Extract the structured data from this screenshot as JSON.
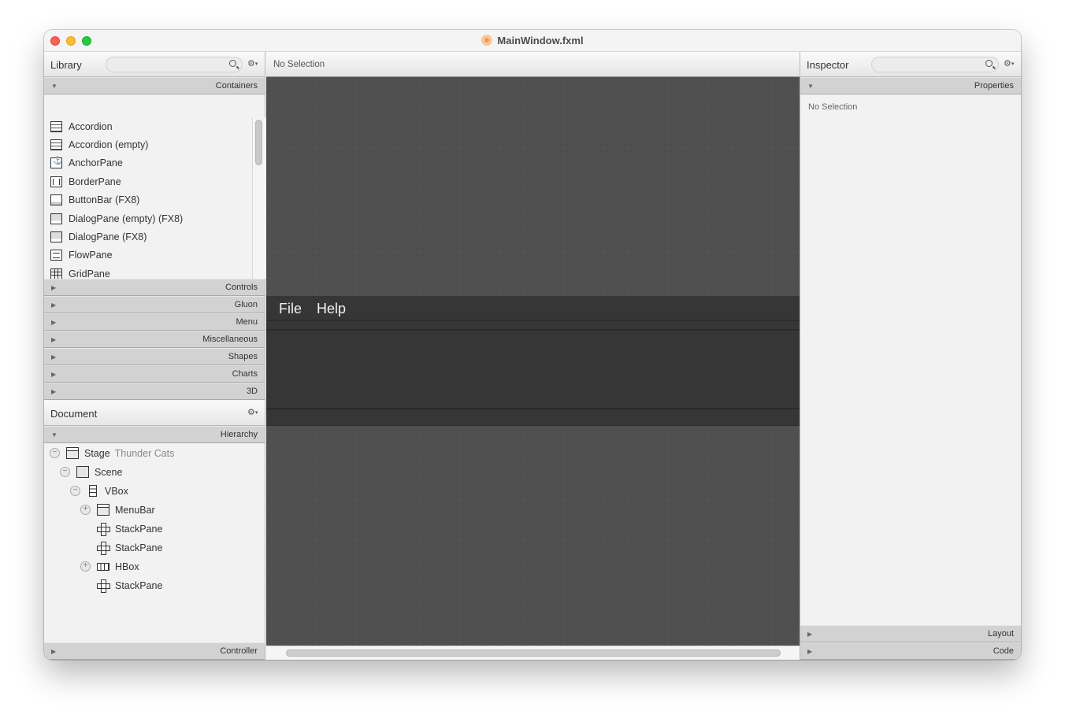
{
  "window": {
    "title": "MainWindow.fxml",
    "title_icon": "fxml-file-icon"
  },
  "library": {
    "title": "Library",
    "search_placeholder": "",
    "expanded_section": "Containers",
    "items": [
      {
        "label": "Accordion",
        "icon": "accordion-icon"
      },
      {
        "label": "Accordion  (empty)",
        "icon": "accordion-icon"
      },
      {
        "label": "AnchorPane",
        "icon": "anchor-pane-icon"
      },
      {
        "label": "BorderPane",
        "icon": "border-pane-icon"
      },
      {
        "label": "ButtonBar  (FX8)",
        "icon": "button-bar-icon"
      },
      {
        "label": "DialogPane (empty)  (FX8)",
        "icon": "dialog-pane-icon"
      },
      {
        "label": "DialogPane  (FX8)",
        "icon": "dialog-pane-icon"
      },
      {
        "label": "FlowPane",
        "icon": "flow-pane-icon"
      },
      {
        "label": "GridPane",
        "icon": "grid-pane-icon"
      }
    ],
    "collapsed_sections": [
      "Controls",
      "Gluon",
      "Menu",
      "Miscellaneous",
      "Shapes",
      "Charts",
      "3D"
    ]
  },
  "document": {
    "title": "Document",
    "section": "Hierarchy",
    "tree": [
      {
        "label": "Stage",
        "sub": "Thunder Cats",
        "toggle": "−",
        "icon": "stage"
      },
      {
        "label": "Scene",
        "sub": "",
        "toggle": "−",
        "icon": "scene"
      },
      {
        "label": "VBox",
        "sub": "",
        "toggle": "−",
        "icon": "vbox"
      },
      {
        "label": "MenuBar",
        "sub": "",
        "toggle": "+",
        "icon": "stage"
      },
      {
        "label": "StackPane",
        "sub": "",
        "toggle": "",
        "icon": "stack"
      },
      {
        "label": "StackPane",
        "sub": "",
        "toggle": "",
        "icon": "stack"
      },
      {
        "label": "HBox",
        "sub": "",
        "toggle": "+",
        "icon": "hbox"
      },
      {
        "label": "StackPane",
        "sub": "",
        "toggle": "",
        "icon": "stack"
      }
    ],
    "controller_label": "Controller"
  },
  "editor": {
    "selection_label": "No Selection",
    "preview_menus": [
      "File",
      "Help"
    ]
  },
  "inspector": {
    "title": "Inspector",
    "search_placeholder": "",
    "section": "Properties",
    "no_selection": "No Selection",
    "collapsed_sections": [
      "Layout",
      "Code"
    ]
  }
}
